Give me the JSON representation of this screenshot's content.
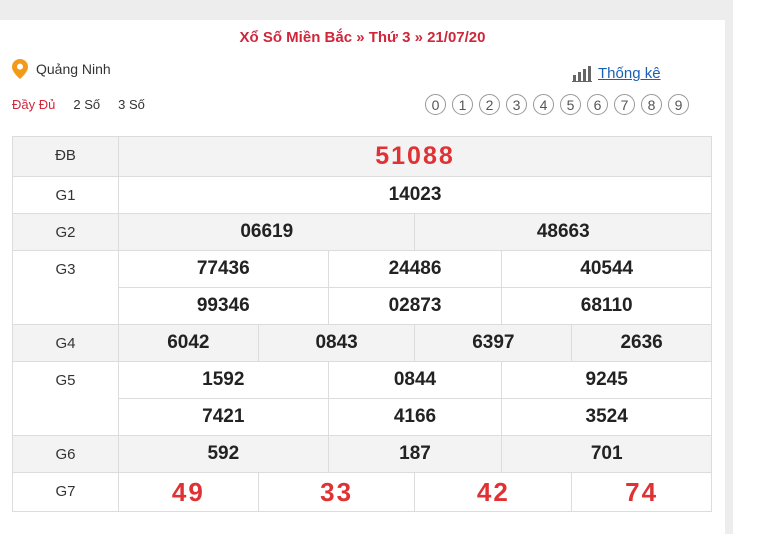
{
  "header": {
    "title": "Xổ Số Miền Bắc » Thứ 3 » 21/07/20",
    "location": "Quảng Ninh",
    "stats_link": "Thống kê"
  },
  "modes": [
    "Đầy Đủ",
    "2 Số",
    "3 Số"
  ],
  "digits": [
    "0",
    "1",
    "2",
    "3",
    "4",
    "5",
    "6",
    "7",
    "8",
    "9"
  ],
  "prizes": {
    "db": {
      "label": "ĐB",
      "values": [
        "51088"
      ]
    },
    "g1": {
      "label": "G1",
      "values": [
        "14023"
      ]
    },
    "g2": {
      "label": "G2",
      "values": [
        "06619",
        "48663"
      ]
    },
    "g3": {
      "label": "G3",
      "values": [
        "77436",
        "24486",
        "40544",
        "99346",
        "02873",
        "68110"
      ]
    },
    "g4": {
      "label": "G4",
      "values": [
        "6042",
        "0843",
        "6397",
        "2636"
      ]
    },
    "g5": {
      "label": "G5",
      "values": [
        "1592",
        "0844",
        "9245",
        "7421",
        "4166",
        "3524"
      ]
    },
    "g6": {
      "label": "G6",
      "values": [
        "592",
        "187",
        "701"
      ]
    },
    "g7": {
      "label": "G7",
      "values": [
        "49",
        "33",
        "42",
        "74"
      ]
    }
  },
  "colors": {
    "accent": "#d0263b",
    "link": "#1b5fb8",
    "pin": "#f29a1a"
  }
}
